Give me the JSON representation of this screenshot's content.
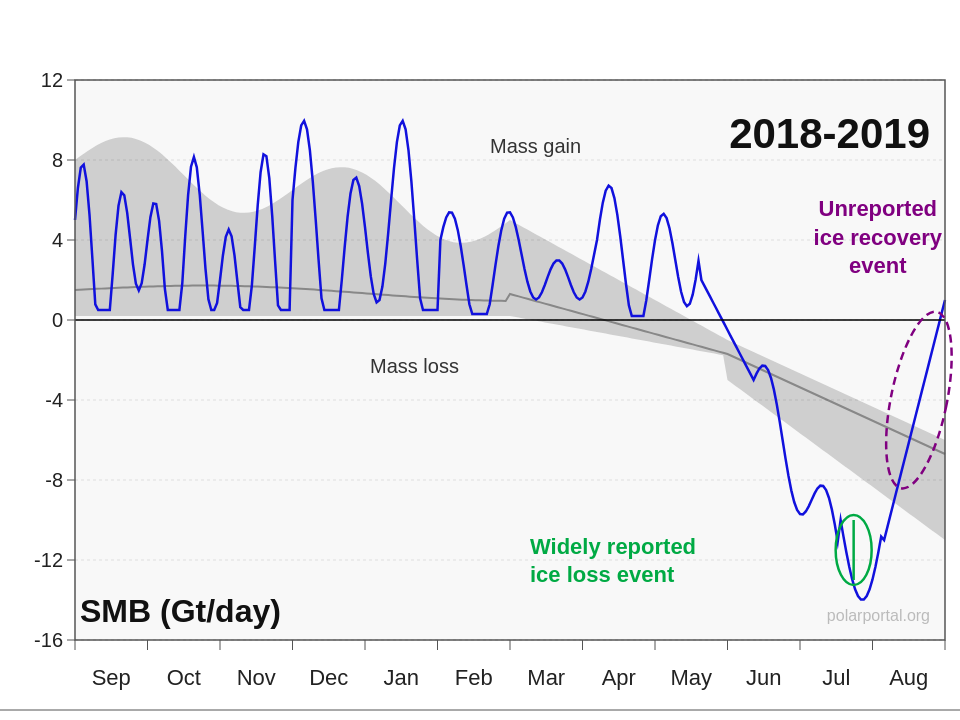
{
  "chart": {
    "title": "2018-2019",
    "y_axis": {
      "label": "SMB (Gt/day)",
      "ticks": [
        12,
        8,
        4,
        0,
        -4,
        -8,
        -12,
        -16
      ],
      "min": -16,
      "max": 12
    },
    "x_axis": {
      "months": [
        "Sep",
        "Oct",
        "Nov",
        "Dec",
        "Jan",
        "Feb",
        "Mar",
        "Apr",
        "May",
        "Jun",
        "Jul",
        "Aug"
      ]
    },
    "annotations": {
      "mass_gain": "Mass gain",
      "mass_loss": "Mass loss",
      "unreported": "Unreported\nice recovery\nevent",
      "widely_reported": "Widely reported\nice loss event",
      "source": "polarportal.org"
    },
    "colors": {
      "blue_line": "#0000cc",
      "gray_line": "#888888",
      "gray_fill": "#cccccc",
      "green_annotation": "#00aa44",
      "purple_annotation": "#800080",
      "zero_line": "#000000",
      "axis_line": "#555555"
    }
  }
}
